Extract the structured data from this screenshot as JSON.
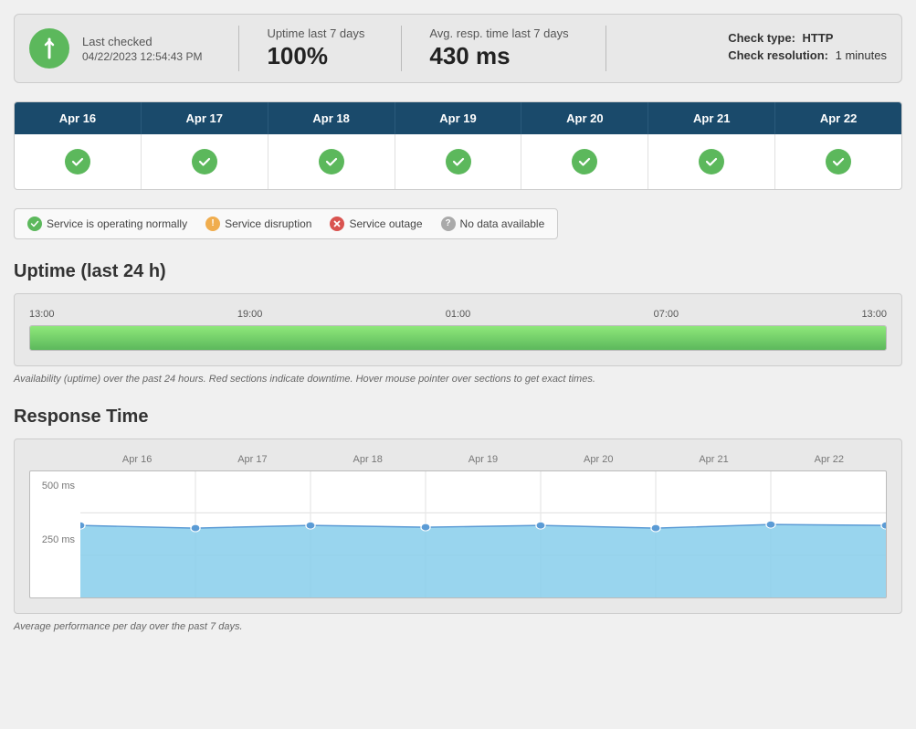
{
  "statusBar": {
    "lastCheckedLabel": "Last checked",
    "lastCheckedDate": "04/22/2023 12:54:43 PM",
    "uptimeLabel": "Uptime last 7 days",
    "uptimeValue": "100%",
    "avgRespLabel": "Avg. resp. time last 7 days",
    "avgRespValue": "430 ms",
    "checkTypeLabel": "Check type:",
    "checkTypeValue": "HTTP",
    "checkResLabel": "Check resolution:",
    "checkResValue": "1 minutes"
  },
  "calendarDays": [
    {
      "label": "Apr 16"
    },
    {
      "label": "Apr 17"
    },
    {
      "label": "Apr 18"
    },
    {
      "label": "Apr 19"
    },
    {
      "label": "Apr 20"
    },
    {
      "label": "Apr 21"
    },
    {
      "label": "Apr 22"
    }
  ],
  "legend": {
    "ok": "Service is operating normally",
    "disruption": "Service disruption",
    "outage": "Service outage",
    "nodata": "No data available"
  },
  "uptime": {
    "title": "Uptime (last 24 h)",
    "timeLabels": [
      "13:00",
      "19:00",
      "01:00",
      "07:00",
      "13:00"
    ],
    "barPercent": 100,
    "note": "Availability (uptime) over the past 24 hours. Red sections indicate downtime. Hover mouse pointer over sections to get exact times."
  },
  "responseTime": {
    "title": "Response Time",
    "xLabels": [
      "Apr 16",
      "Apr 17",
      "Apr 18",
      "Apr 19",
      "Apr 20",
      "Apr 21",
      "Apr 22"
    ],
    "yLabels": [
      "500 ms",
      "250 ms"
    ],
    "note": "Average performance per day over the past 7 days.",
    "dataPoints": [
      430,
      420,
      430,
      425,
      430,
      420,
      440
    ]
  }
}
